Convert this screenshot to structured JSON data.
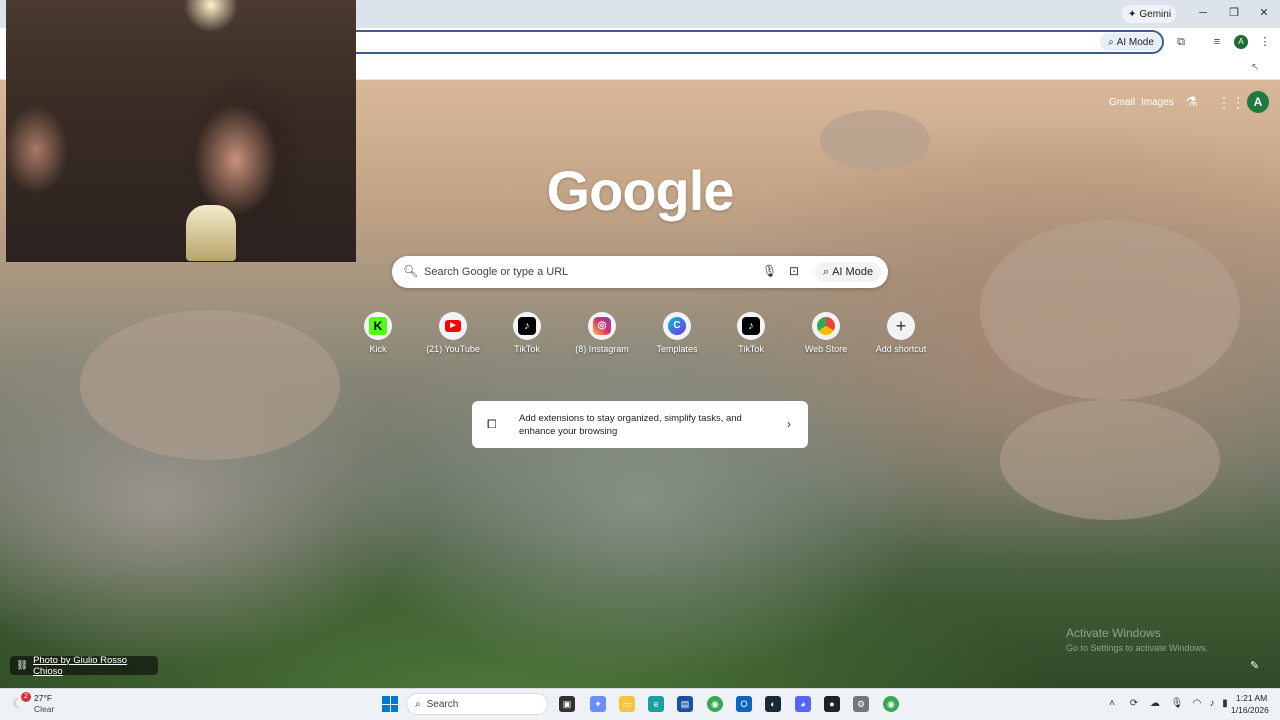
{
  "titlebar": {
    "gemini_label": "Gemini",
    "minimize": "─",
    "restore": "❐",
    "close": "✕"
  },
  "toolbar": {
    "ai_mode_label": "AI Mode",
    "profile_letter": "A"
  },
  "ntp": {
    "gmail": "Gmail",
    "images": "Images",
    "avatar_letter": "A",
    "logo": "Google",
    "search": {
      "placeholder": "Search Google or type a URL",
      "ai_mode_label": "AI Mode"
    },
    "shortcuts": [
      {
        "label": "Kick",
        "glyph": "K"
      },
      {
        "label": "(21) YouTube",
        "glyph": "▶"
      },
      {
        "label": "TikTok",
        "glyph": "♪"
      },
      {
        "label": "(8) Instagram",
        "glyph": "◎"
      },
      {
        "label": "Templates",
        "glyph": "C"
      },
      {
        "label": "TikTok",
        "glyph": "♪"
      },
      {
        "label": "Web Store",
        "glyph": ""
      },
      {
        "label": "Add shortcut",
        "glyph": "+"
      }
    ],
    "extension_card": {
      "text": "Add extensions to stay organized, simplify tasks, and enhance your browsing"
    },
    "photo_credit": "Photo by Giulio Rosso Chioso",
    "activate": {
      "title": "Activate Windows",
      "subtitle": "Go to Settings to activate Windows."
    }
  },
  "taskbar": {
    "weather": {
      "badge": "2",
      "temp": "27°F",
      "condition": "Clear"
    },
    "search_label": "Search",
    "clock": {
      "time": "1:21 AM",
      "date": "1/16/2026"
    }
  },
  "colors": {
    "accent": "#0078d4",
    "profile": "#1f7a3d",
    "omnibox_border": "#3b5e8c"
  }
}
